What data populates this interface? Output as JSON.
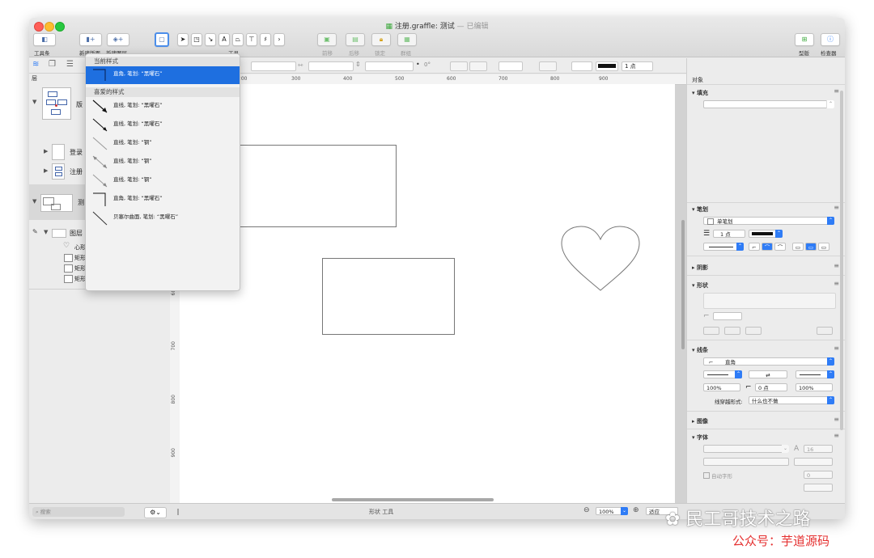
{
  "window": {
    "filename": "注册.graffle",
    "doc": "测试",
    "status": "已编辑"
  },
  "toolbar": {
    "toolbar_label": "工具条",
    "new_canvas": "新建版面",
    "new_layer": "新建图层",
    "tools": "工具",
    "bring_front": "前移",
    "send_back": "后移",
    "lock": "锁定",
    "group": "群组",
    "stencil": "型版",
    "inspector": "检查器",
    "text_tool_glyph": "A"
  },
  "format_bar": {
    "stroke_width": "1 点",
    "degree": "0°"
  },
  "sidebar": {
    "layers_header": "层",
    "canvases": [
      {
        "label": "版"
      },
      {
        "label": "登录"
      },
      {
        "label": "注册"
      },
      {
        "label": "测"
      }
    ],
    "layer_name": "图层",
    "objects": [
      "心形",
      "矩形",
      "矩形",
      "矩形"
    ],
    "search_placeholder": "搜索"
  },
  "ruler": {
    "top": [
      "200",
      "300",
      "400",
      "500",
      "600",
      "700",
      "800",
      "900"
    ],
    "left": [
      "600",
      "700",
      "800",
      "900"
    ]
  },
  "dropdown": {
    "current_header": "当前样式",
    "current_item": "直角, 笔划: “黑曜石”",
    "favorites_header": "喜爱的样式",
    "favorites": [
      "直线, 笔划: “黑曜石”",
      "直线, 笔划: “黑曜石”",
      "直线, 笔划: “钢”",
      "直线, 笔划: “钢”",
      "直线, 笔划: “钢”",
      "直角, 笔划: “黑曜石”",
      "贝塞尔曲面, 笔划: “黑曜石”"
    ]
  },
  "inspector": {
    "tab_title": "对象",
    "fill": "填充",
    "stroke": "笔划",
    "stroke_type": "单笔划",
    "stroke_width": "1 点",
    "shadow": "阴影",
    "shape": "形状",
    "lines": "线条",
    "line_type": "直角",
    "line_pct_a": "100%",
    "line_points": "0 点",
    "line_pct_b": "100%",
    "line_cross_label": "线穿越形式:",
    "line_cross_value": "什么也不做",
    "image": "图像",
    "font": "字体",
    "font_size": "16",
    "font_number": "0",
    "auto_font": "自动字形"
  },
  "status": {
    "text": "形状 工具",
    "zoom": "100%",
    "fit": "适应"
  },
  "watermark": {
    "line1": "民工哥技术之路",
    "line2": "公众号：芋道源码"
  },
  "colors": {
    "accent": "#1e6fe0",
    "selection": "#4c8eea"
  }
}
